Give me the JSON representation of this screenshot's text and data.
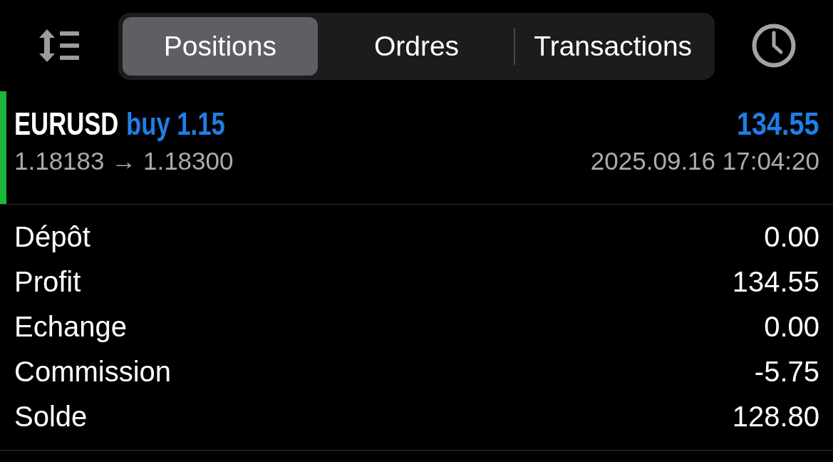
{
  "toolbar": {
    "tabs": [
      {
        "label": "Positions",
        "selected": true
      },
      {
        "label": "Ordres",
        "selected": false
      },
      {
        "label": "Transactions",
        "selected": false
      }
    ]
  },
  "deals": [
    {
      "symbol": "EURUSD",
      "order": "buy 1.15",
      "profit": "134.55",
      "prices": "1.18183 → 1.18300",
      "time": "2025.09.16 17:04:20",
      "color": "#1db83b"
    }
  ],
  "details": [
    {
      "label": "Dépôt",
      "value": "0.00"
    },
    {
      "label": "Profit",
      "value": "134.55"
    },
    {
      "label": "Echange",
      "value": "0.00"
    },
    {
      "label": "Commission",
      "value": "-5.75"
    },
    {
      "label": "Solde",
      "value": "128.80"
    }
  ]
}
